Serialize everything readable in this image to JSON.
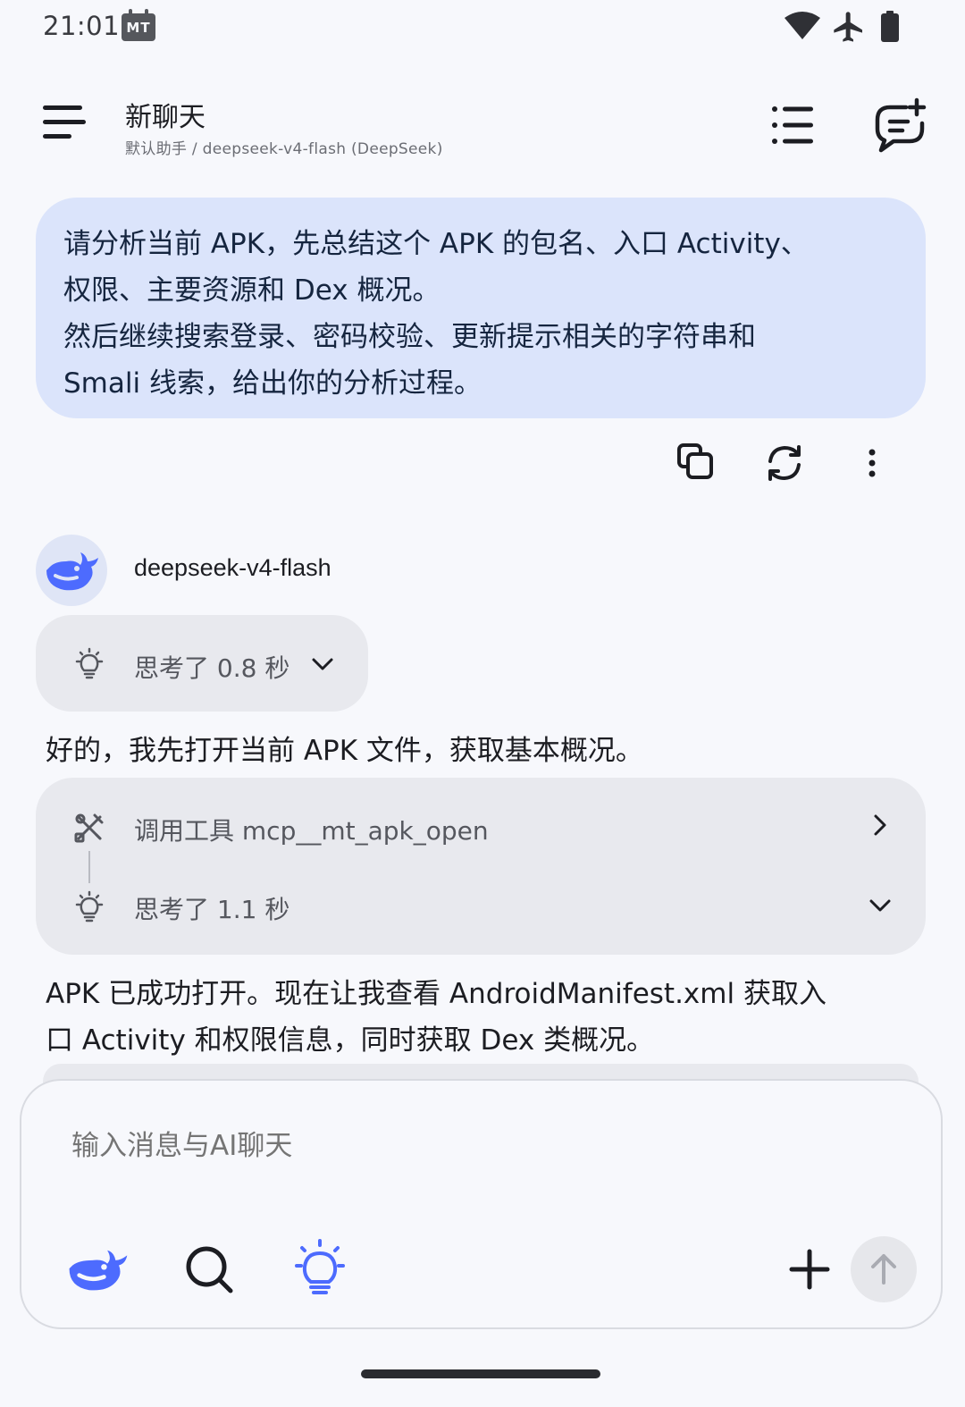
{
  "status_bar": {
    "time": "21:01",
    "notification_badge": "MT",
    "icons": [
      "wifi-icon",
      "airplane-icon",
      "battery-icon"
    ]
  },
  "header": {
    "title": "新聊天",
    "subtitle": "默认助手 / deepseek-v4-flash (DeepSeek)"
  },
  "user_message": {
    "lines": [
      "请分析当前 APK，先总结这个 APK 的包名、入口 Activity、",
      "权限、主要资源和 Dex 概况。",
      "然后继续搜索登录、密码校验、更新提示相关的字符串和",
      "Smali 线索，给出你的分析过程。"
    ],
    "actions": [
      "copy-icon",
      "regenerate-icon",
      "more-vert-icon"
    ]
  },
  "assistant": {
    "model_name": "deepseek-v4-flash",
    "thinking_1": "思考了 0.8 秒",
    "reply_1": "好的，我先打开当前 APK 文件，获取基本概况。",
    "tool_call": "调用工具 mcp__mt_apk_open",
    "thinking_2": "思考了 1.1 秒",
    "reply_2_lines": [
      "APK 已成功打开。现在让我查看 AndroidManifest.xml 获取入",
      "口 Activity 和权限信息，同时获取 Dex 类概况。"
    ]
  },
  "composer": {
    "placeholder": "输入消息与AI聊天"
  },
  "colors": {
    "background": "#f7f8fc",
    "user_bubble": "#dbe4fb",
    "card": "#e8e9ee",
    "deepseek_blue": "#4d6bfe"
  }
}
